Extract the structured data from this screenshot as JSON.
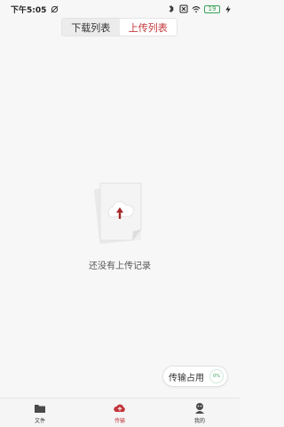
{
  "status": {
    "time": "下午5:05",
    "battery": "19"
  },
  "tabs": [
    {
      "label": "下载列表",
      "active": false
    },
    {
      "label": "上传列表",
      "active": true
    }
  ],
  "empty_state": {
    "icon": "cloud-upload-icon",
    "message": "还没有上传记录"
  },
  "transfer": {
    "label": "传输占用",
    "percent_text": "0%",
    "percent_value": 0
  },
  "bottom_nav": [
    {
      "label": "文件",
      "icon": "folder-icon"
    },
    {
      "label": "传输",
      "icon": "cloud-transfer-icon",
      "active": true
    },
    {
      "label": "我的",
      "icon": "user-icon"
    }
  ],
  "colors": {
    "accent": "#c2363a",
    "battery": "#3aa35a",
    "background": "#f7f7f7"
  }
}
